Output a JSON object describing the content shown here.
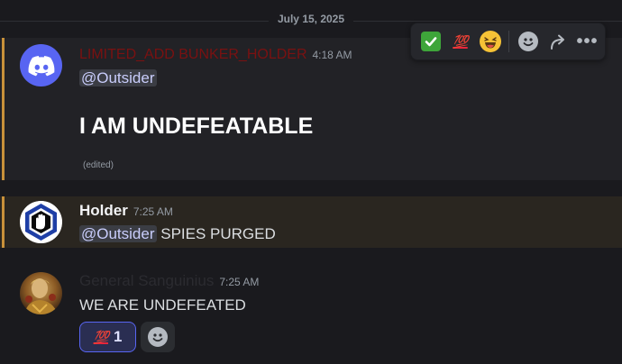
{
  "date_divider": "July 15, 2025",
  "toolbar": {
    "reactions": [
      "white-check-mark",
      "hundred-points",
      "laughing-face"
    ],
    "hundred_label": "💯",
    "actions": [
      "add-reaction",
      "forward",
      "more"
    ],
    "more_label": "•••"
  },
  "messages": [
    {
      "author": "LIMITED_ADD BUNKER_HOLDER",
      "author_color": "#7a1111",
      "time": "4:18 AM",
      "mention": "@Outsider",
      "body": "I AM UNDEFEATABLE",
      "edited": "(edited)"
    },
    {
      "author": "Holder",
      "time": "7:25 AM",
      "mention": "@Outsider",
      "body": " SPIES PURGED"
    },
    {
      "author": "General Sanguinius",
      "author_color": "#2b2b30",
      "time": "7:25 AM",
      "body": "WE ARE UNDEFEATED",
      "reactions": [
        {
          "emoji_label": "💯",
          "emoji": "hundred-points",
          "count": "1",
          "active": true
        }
      ]
    }
  ],
  "colors": {
    "background": "#1a1a1e",
    "accent": "#5865f2",
    "highlight_bar": "#c8913a",
    "mention_bg": "#2a2620"
  }
}
